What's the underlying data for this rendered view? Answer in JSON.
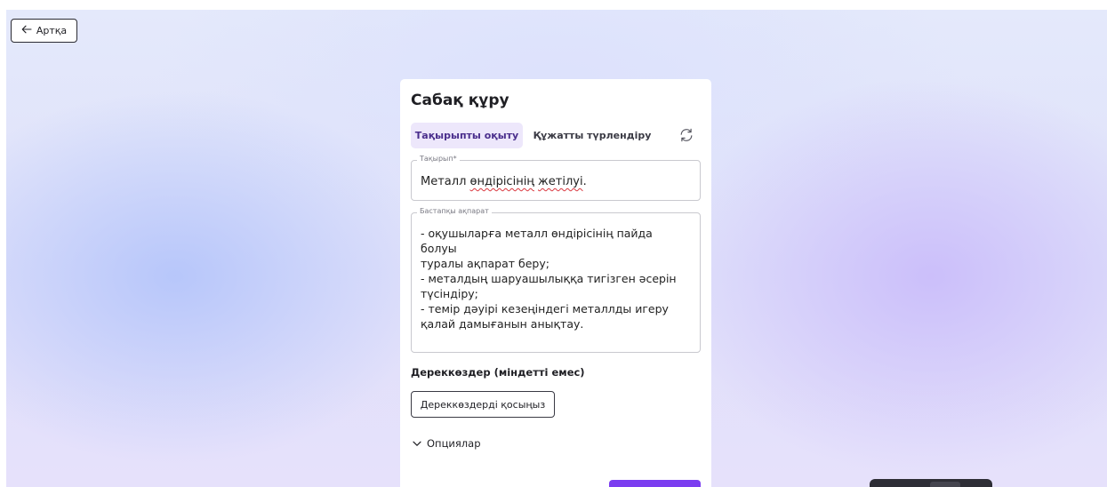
{
  "nav": {
    "back_label": "Артқа"
  },
  "card": {
    "title": "Сабақ құру",
    "tabs": [
      {
        "label": "Тақырыпты оқыту",
        "active": true
      },
      {
        "label": "Құжатты түрлендіру",
        "active": false
      }
    ],
    "topic": {
      "label": "Тақырып*",
      "value_parts": [
        "Металл ",
        "өндірісінің",
        " ",
        "жетілуі",
        "."
      ]
    },
    "source_info": {
      "label": "Бастапқы ақпарат",
      "value": "- оқушыларға металл өндірісінің пайда болуы\nтуралы ақпарат беру;\n- металдың шаруашылыққа тигізген әсерін\nтүсіндіру;\n- темір дәуірі кезеңіндегі металлды игеру\nқалай дамығанын анықтау."
    },
    "sources": {
      "label": "Дереккөздер (міндетті емес)",
      "add_button": "Дереккөздерді қосыңыз"
    },
    "options_label": "Опциялар"
  },
  "colors": {
    "accent": "#7b3df0",
    "tab_active_bg": "#ede7fb",
    "tab_active_text": "#4a2e8c"
  },
  "icons": [
    "arrow-left-icon",
    "refresh-icon",
    "chevron-down-icon"
  ]
}
